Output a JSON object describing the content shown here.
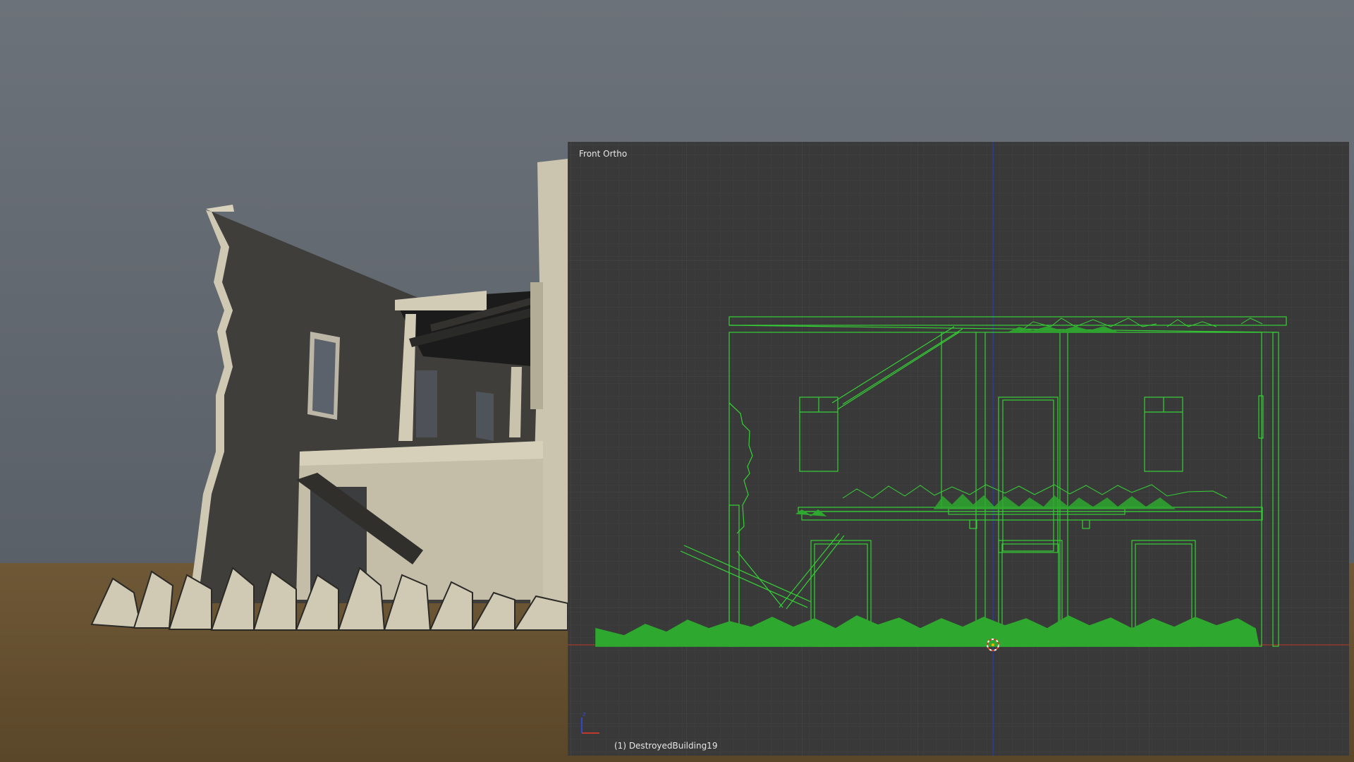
{
  "viewport": {
    "view_name": "Front Ortho",
    "object_label": "(1) DestroyedBuilding19"
  },
  "colors": {
    "sky_top": "#6d737a",
    "sky_bottom": "#5b6168",
    "ground": "#6b5535",
    "wall_lit": "#c9c3ae",
    "wall_shadow": "#3f3e3a",
    "viewport_bg": "#393939",
    "wireframe": "#35d135",
    "grass": "#2ea82e",
    "x_axis": "#c0392b",
    "y_axis": "#2a3aa8"
  },
  "icons": [
    "axis-gizmo-icon",
    "3d-cursor-icon"
  ]
}
